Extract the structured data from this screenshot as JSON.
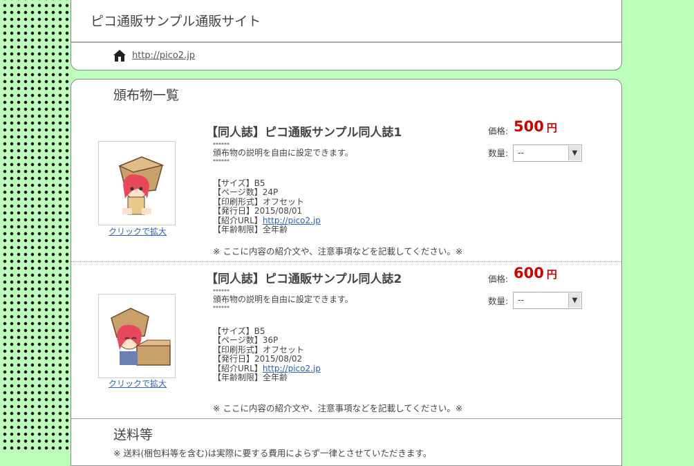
{
  "site": {
    "title": "ピコ通販サンプル通販サイト",
    "home_url": "http://pico2.jp"
  },
  "catalog": {
    "heading": "頒布物一覧",
    "zoom_label": "クリックで拡大",
    "price_label": "価格:",
    "yen": "円",
    "qty_label": "数量:",
    "items": [
      {
        "title": "【同人誌】ピコ通販サンプル同人誌1",
        "stars_top": "******",
        "description": "頒布物の説明を自由に設定できます。",
        "stars_bottom": "******",
        "size": "【サイズ】B5",
        "pages": "【ページ数】24P",
        "printing": "【印刷形式】オフセット",
        "release": "【発行日】2015/08/01",
        "url_label": "【紹介URL】",
        "url": "http://pico2.jp",
        "age": "【年齢制限】全年齢",
        "note": "※ ここに内容の紹介文や、注意事項などを記載してください。※",
        "price": "500",
        "qty": "--"
      },
      {
        "title": "【同人誌】ピコ通販サンプル同人誌2",
        "stars_top": "******",
        "description": "頒布物の説明を自由に設定できます。",
        "stars_bottom": "******",
        "size": "【サイズ】B5",
        "pages": "【ページ数】36P",
        "printing": "【印刷形式】オフセット",
        "release": "【発行日】2015/08/02",
        "url_label": "【紹介URL】",
        "url": "http://pico2.jp",
        "age": "【年齢制限】全年齢",
        "note": "※ ここに内容の紹介文や、注意事項などを記載してください。※",
        "price": "600",
        "qty": "--"
      }
    ]
  },
  "shipping": {
    "heading": "送料等",
    "text": "※ 送料(梱包料等を含む)は実際に要する費用によらず一律とさせていただきます。"
  }
}
